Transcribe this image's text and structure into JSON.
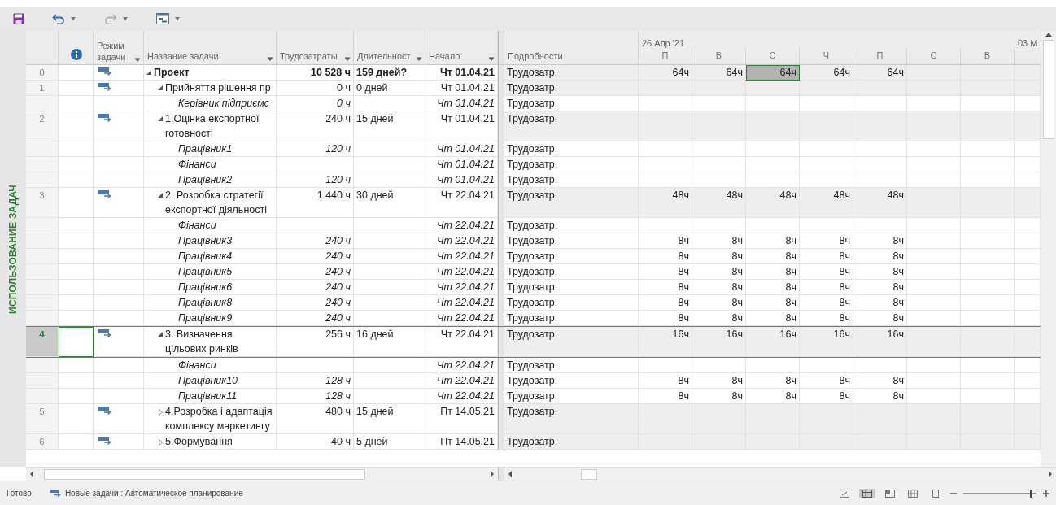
{
  "view_label": "ИСПОЛЬЗОВАНИЕ ЗАДАЧ",
  "table": {
    "columns": [
      {
        "label": "Режим задачи",
        "filter": true
      },
      {
        "label": "Название задачи",
        "filter": true
      },
      {
        "label": "Трудозатраты",
        "filter": true
      },
      {
        "label": "Длительност",
        "filter": true
      },
      {
        "label": "Начало",
        "filter": true
      }
    ],
    "rows": [
      {
        "kind": "project",
        "id": "0",
        "selected": false,
        "expanded": true,
        "name": "Проект",
        "work": "10 528 ч",
        "duration": "159 дней?",
        "start": "Чт 01.04.21",
        "detail": "Трудозатр.",
        "values": [
          {
            "text": "64ч",
            "selected": false
          },
          {
            "text": "64ч",
            "selected": false
          },
          {
            "text": "64ч",
            "selected": true
          },
          {
            "text": "64ч",
            "selected": false
          },
          {
            "text": "64ч",
            "selected": false
          }
        ]
      },
      {
        "kind": "task",
        "id": "1",
        "selected": false,
        "expanded": true,
        "name": "Прийняття рішення пр",
        "work": "0 ч",
        "duration": "0 дней",
        "start": "Чт 01.04.21",
        "detail": "Трудозатр."
      },
      {
        "kind": "assignment",
        "selected": false,
        "name": "Керівник підприємс",
        "work": "0 ч",
        "start": "Чт 01.04.21",
        "detail": "Трудозатр."
      },
      {
        "kind": "task",
        "id": "2",
        "selected": false,
        "expanded": true,
        "name": "1.Оцінка експортної готовності",
        "work": "240 ч",
        "duration": "15 дней",
        "start": "Чт 01.04.21",
        "detail": "Трудозатр."
      },
      {
        "kind": "assignment",
        "selected": false,
        "name": "Працівник1",
        "work": "120 ч",
        "start": "Чт 01.04.21",
        "detail": "Трудозатр."
      },
      {
        "kind": "assignment",
        "selected": false,
        "name": "Фінанси",
        "start": "Чт 01.04.21",
        "detail": "Трудозатр."
      },
      {
        "kind": "assignment",
        "selected": false,
        "name": "Працівник2",
        "work": "120 ч",
        "start": "Чт 01.04.21",
        "detail": "Трудозатр."
      },
      {
        "kind": "task",
        "id": "3",
        "selected": false,
        "expanded": true,
        "name": "2. Розробка стратегії експортної діяльності",
        "work": "1 440 ч",
        "duration": "30 дней",
        "start": "Чт 22.04.21",
        "detail": "Трудозатр.",
        "values": [
          {
            "text": "48ч",
            "selected": false
          },
          {
            "text": "48ч",
            "selected": false
          },
          {
            "text": "48ч",
            "selected": false
          },
          {
            "text": "48ч",
            "selected": false
          },
          {
            "text": "48ч",
            "selected": false
          }
        ]
      },
      {
        "kind": "assignment",
        "selected": false,
        "name": "Фінанси",
        "start": "Чт 22.04.21",
        "detail": "Трудозатр."
      },
      {
        "kind": "assignment",
        "selected": false,
        "name": "Працівник3",
        "work": "240 ч",
        "start": "Чт 22.04.21",
        "detail": "Трудозатр.",
        "values": [
          {
            "text": "8ч",
            "selected": false
          },
          {
            "text": "8ч",
            "selected": false
          },
          {
            "text": "8ч",
            "selected": false
          },
          {
            "text": "8ч",
            "selected": false
          },
          {
            "text": "8ч",
            "selected": false
          }
        ]
      },
      {
        "kind": "assignment",
        "selected": false,
        "name": "Працівник4",
        "work": "240 ч",
        "start": "Чт 22.04.21",
        "detail": "Трудозатр.",
        "values": [
          {
            "text": "8ч",
            "selected": false
          },
          {
            "text": "8ч",
            "selected": false
          },
          {
            "text": "8ч",
            "selected": false
          },
          {
            "text": "8ч",
            "selected": false
          },
          {
            "text": "8ч",
            "selected": false
          }
        ]
      },
      {
        "kind": "assignment",
        "selected": false,
        "name": "Працівник5",
        "work": "240 ч",
        "start": "Чт 22.04.21",
        "detail": "Трудозатр.",
        "values": [
          {
            "text": "8ч",
            "selected": false
          },
          {
            "text": "8ч",
            "selected": false
          },
          {
            "text": "8ч",
            "selected": false
          },
          {
            "text": "8ч",
            "selected": false
          },
          {
            "text": "8ч",
            "selected": false
          }
        ]
      },
      {
        "kind": "assignment",
        "selected": false,
        "name": "Працівник6",
        "work": "240 ч",
        "start": "Чт 22.04.21",
        "detail": "Трудозатр.",
        "values": [
          {
            "text": "8ч",
            "selected": false
          },
          {
            "text": "8ч",
            "selected": false
          },
          {
            "text": "8ч",
            "selected": false
          },
          {
            "text": "8ч",
            "selected": false
          },
          {
            "text": "8ч",
            "selected": false
          }
        ]
      },
      {
        "kind": "assignment",
        "selected": false,
        "name": "Працівник8",
        "work": "240 ч",
        "start": "Чт 22.04.21",
        "detail": "Трудозатр.",
        "values": [
          {
            "text": "8ч",
            "selected": false
          },
          {
            "text": "8ч",
            "selected": false
          },
          {
            "text": "8ч",
            "selected": false
          },
          {
            "text": "8ч",
            "selected": false
          },
          {
            "text": "8ч",
            "selected": false
          }
        ]
      },
      {
        "kind": "assignment",
        "selected": false,
        "name": "Працівник9",
        "work": "240 ч",
        "start": "Чт 22.04.21",
        "detail": "Трудозатр.",
        "values": [
          {
            "text": "8ч",
            "selected": false
          },
          {
            "text": "8ч",
            "selected": false
          },
          {
            "text": "8ч",
            "selected": false
          },
          {
            "text": "8ч",
            "selected": false
          },
          {
            "text": "8ч",
            "selected": false
          }
        ]
      },
      {
        "kind": "task",
        "id": "4",
        "selected": true,
        "expanded": true,
        "name": "3. Визначення цільових ринків",
        "work": "256 ч",
        "duration": "16 дней",
        "start": "Чт 22.04.21",
        "detail": "Трудозатр.",
        "values": [
          {
            "text": "16ч",
            "selected": false
          },
          {
            "text": "16ч",
            "selected": false
          },
          {
            "text": "16ч",
            "selected": false
          },
          {
            "text": "16ч",
            "selected": false
          },
          {
            "text": "16ч",
            "selected": false
          }
        ]
      },
      {
        "kind": "assignment",
        "selected": false,
        "name": "Фінанси",
        "start": "Чт 22.04.21",
        "detail": "Трудозатр."
      },
      {
        "kind": "assignment",
        "selected": false,
        "name": "Працівник10",
        "work": "128 ч",
        "start": "Чт 22.04.21",
        "detail": "Трудозатр.",
        "values": [
          {
            "text": "8ч",
            "selected": false
          },
          {
            "text": "8ч",
            "selected": false
          },
          {
            "text": "8ч",
            "selected": false
          },
          {
            "text": "8ч",
            "selected": false
          },
          {
            "text": "8ч",
            "selected": false
          }
        ]
      },
      {
        "kind": "assignment",
        "selected": false,
        "name": "Працівник11",
        "work": "128 ч",
        "start": "Чт 22.04.21",
        "detail": "Трудозатр.",
        "values": [
          {
            "text": "8ч",
            "selected": false
          },
          {
            "text": "8ч",
            "selected": false
          },
          {
            "text": "8ч",
            "selected": false
          },
          {
            "text": "8ч",
            "selected": false
          },
          {
            "text": "8ч",
            "selected": false
          }
        ]
      },
      {
        "kind": "task",
        "id": "5",
        "selected": false,
        "expanded": false,
        "name": "4.Розробка і адаптація комплексу маркетингу",
        "work": "480 ч",
        "duration": "15 дней",
        "start": "Пт 14.05.21",
        "detail": "Трудозатр."
      },
      {
        "kind": "task",
        "id": "6",
        "selected": false,
        "expanded": false,
        "name": "5.Формування",
        "work": "40 ч",
        "duration": "5 дней",
        "start": "Пт 14.05.21",
        "detail": "Трудозатр."
      }
    ]
  },
  "timeline": {
    "details_header": "Подробности",
    "weeks": [
      "26 Апр '21",
      "03 М"
    ],
    "days": [
      "П",
      "В",
      "С",
      "Ч",
      "П",
      "С",
      "В"
    ]
  },
  "status_bar": {
    "status": "Готово",
    "mode": "Новые задачи : Автоматическое планирование",
    "zoom": {
      "level": 0.92
    }
  }
}
